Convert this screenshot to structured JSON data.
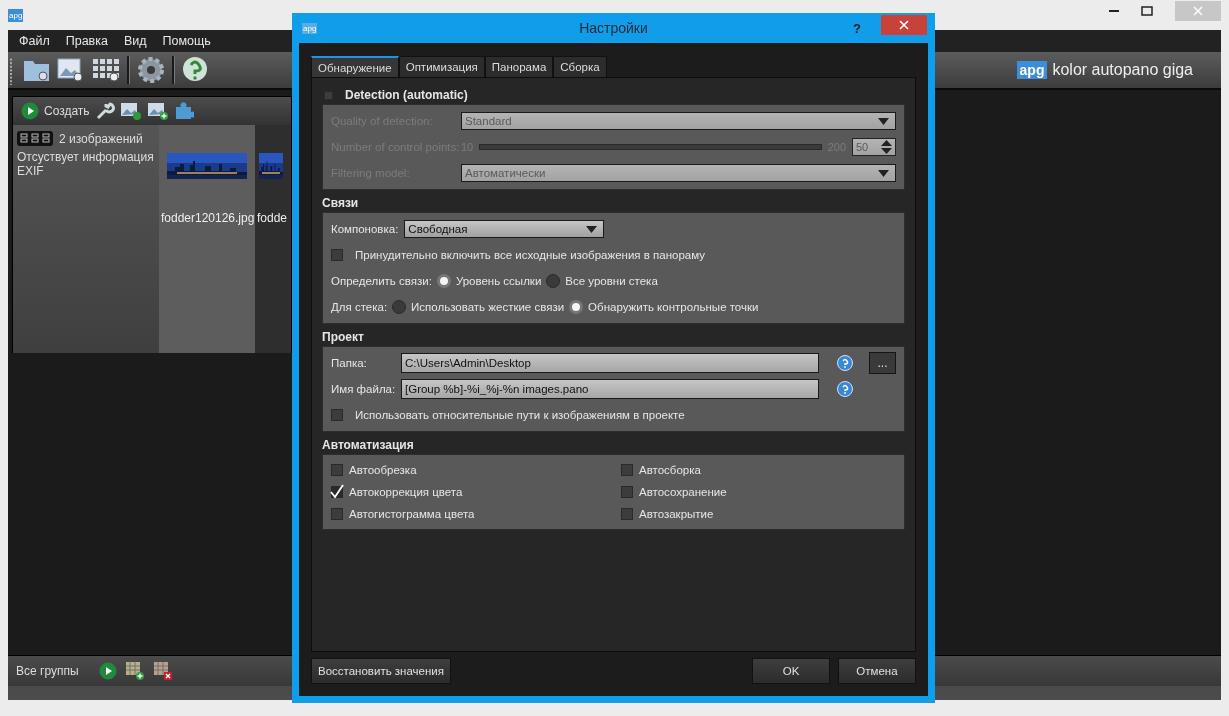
{
  "app_icon": "apg",
  "menu": [
    "Файл",
    "Правка",
    "Вид",
    "Помощь"
  ],
  "brand": {
    "logo": "apg",
    "name": "kolor autopano giga"
  },
  "group": {
    "create": "Создать",
    "count": "2 изображений",
    "info": "Отсуствует информация EXIF",
    "thumbnails": [
      {
        "name": "fodder120126.jpg",
        "selected": true
      },
      {
        "name": "fodde",
        "selected": false
      }
    ]
  },
  "bottom_bar": {
    "label": "Все группы"
  },
  "dialog": {
    "icon": "apg",
    "title": "Настройки",
    "help": "?",
    "tabs": [
      {
        "label": "Обнаружение",
        "selected": true
      },
      {
        "label": "Оптимизация",
        "selected": false
      },
      {
        "label": "Панорама",
        "selected": false
      },
      {
        "label": "Сборка",
        "selected": false
      }
    ],
    "detection": {
      "title": "Detection (automatic)",
      "checked": false,
      "disabled": true,
      "quality": {
        "label": "Quality of detection:",
        "value": "Standard"
      },
      "points": {
        "label": "Number of control points:",
        "min": "10",
        "max": "200",
        "value": "50"
      },
      "filtering": {
        "label": "Filtering model:",
        "value": "Автоматически"
      }
    },
    "links": {
      "title": "Связи",
      "layout": {
        "label": "Компоновка:",
        "value": "Свободная"
      },
      "force": {
        "label": "Принудительно включить все исходные изображения в панораму",
        "checked": false
      },
      "radio_rows": [
        {
          "label": "Определить связи:",
          "options": [
            {
              "label": "Уровень ссылки",
              "selected": true
            },
            {
              "label": "Все уровни стека",
              "selected": false
            }
          ]
        },
        {
          "label": "Для стека:",
          "options": [
            {
              "label": "Использовать жесткие связи",
              "selected": false
            },
            {
              "label": "Обнаружить контрольные точки",
              "selected": true
            }
          ]
        }
      ]
    },
    "project": {
      "title": "Проект",
      "folder": {
        "label": "Папка:",
        "value": "C:\\Users\\Admin\\Desktop",
        "browse": "..."
      },
      "filename": {
        "label": "Имя файла:",
        "value": "[Group %b]-%i_%j-%n images.pano"
      },
      "relative": {
        "label": "Использовать относительные пути к изображениям в проекте",
        "checked": false
      }
    },
    "automation": {
      "title": "Автоматизация",
      "items": [
        {
          "label": "Автообрезка",
          "checked": false
        },
        {
          "label": "Автосборка",
          "checked": false
        },
        {
          "label": "Автокоррекция цвета",
          "checked": true
        },
        {
          "label": "Автосохранение",
          "checked": false
        },
        {
          "label": "Автогистограмма цвета",
          "checked": false
        },
        {
          "label": "Автозакрытие",
          "checked": false
        }
      ]
    },
    "buttons": {
      "restore": "Восстановить значения",
      "ok": "OK",
      "cancel": "Отмена"
    }
  }
}
